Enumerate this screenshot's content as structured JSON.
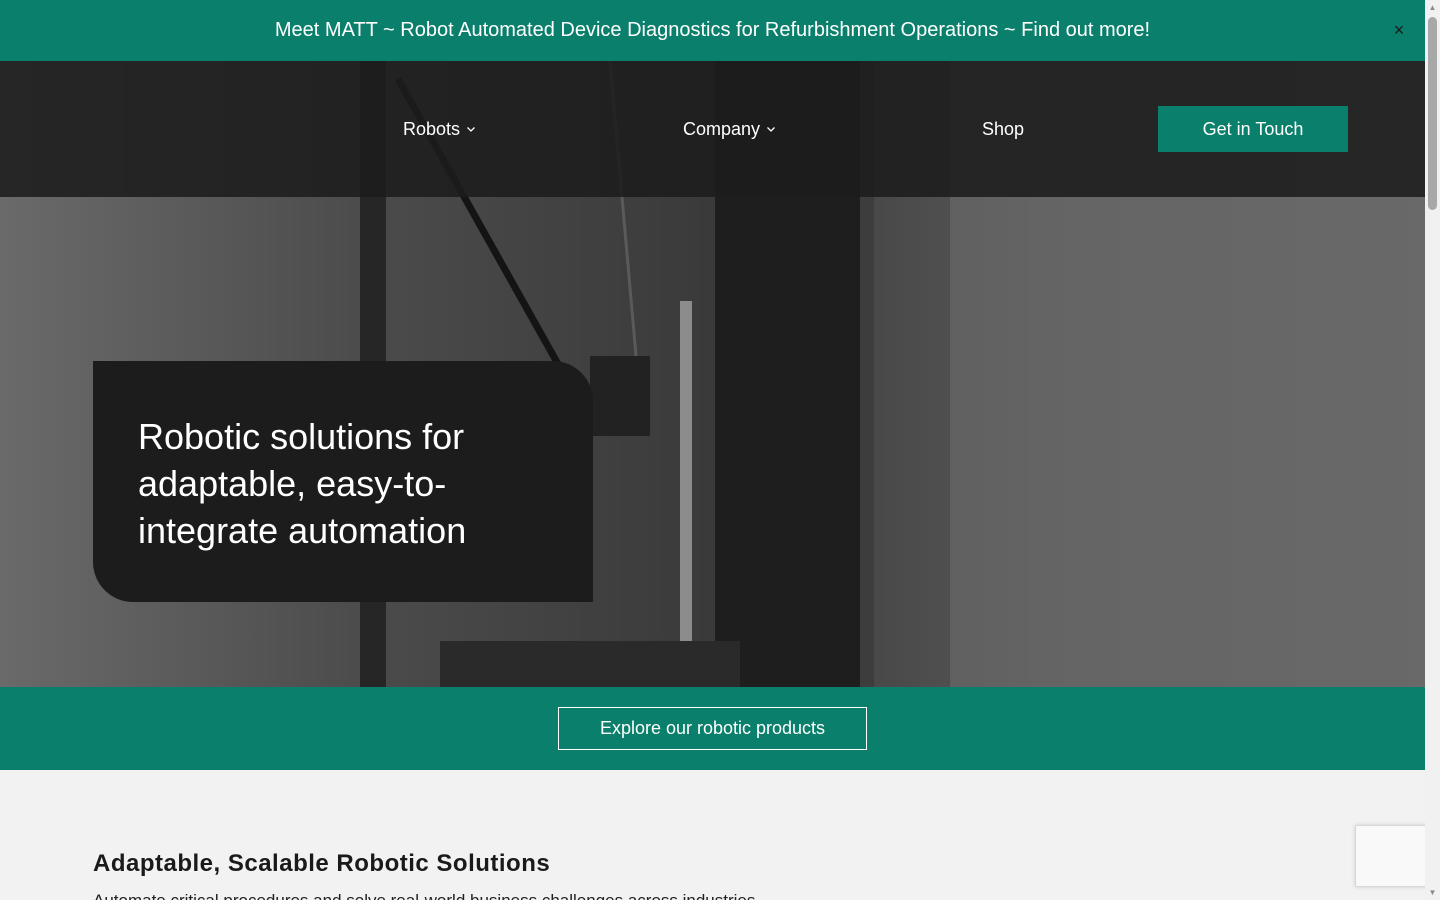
{
  "announcement": {
    "text": "Meet MATT ~ Robot Automated Device Diagnostics for Refurbishment Operations ~ Find out more!",
    "close_symbol": "×"
  },
  "nav": {
    "items": [
      {
        "label": "Robots",
        "has_dropdown": true
      },
      {
        "label": "Company",
        "has_dropdown": true
      },
      {
        "label": "Shop",
        "has_dropdown": false
      }
    ],
    "cta_label": "Get in Touch"
  },
  "hero": {
    "title": "Robotic solutions for adaptable, easy-to-integrate automation",
    "explore_label": "Explore our robotic products"
  },
  "section": {
    "title": "Adaptable, Scalable Robotic Solutions",
    "text": "Automate critical procedures and solve real-world business challenges across industries."
  },
  "colors": {
    "brand_green": "#0a7f6b",
    "dark": "#1c1c1c"
  },
  "icons": {
    "close": "close-icon",
    "dropdown": "chevron-down-icon"
  }
}
